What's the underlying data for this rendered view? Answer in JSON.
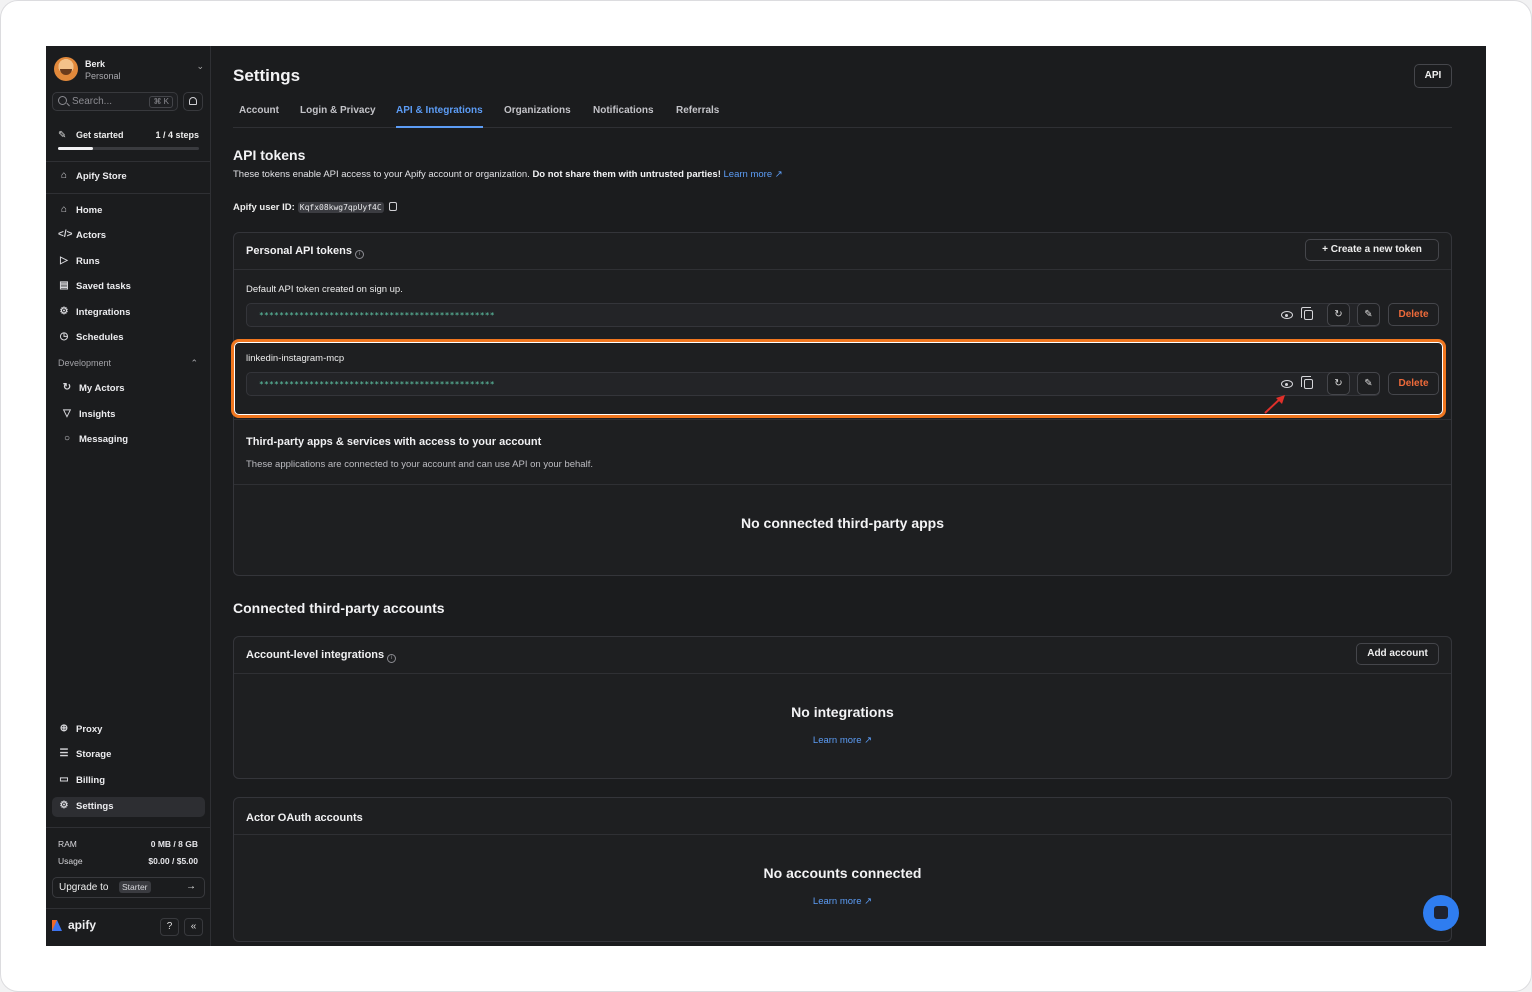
{
  "user": {
    "name": "Berk",
    "plan": "Personal"
  },
  "search": {
    "placeholder": "Search...",
    "shortcut": "⌘ K"
  },
  "get_started": {
    "label": "Get started",
    "steps": "1 / 4 steps",
    "progress": 0.25
  },
  "sidebar": {
    "store": "Apify Store",
    "items": [
      "Home",
      "Actors",
      "Runs",
      "Saved tasks",
      "Integrations",
      "Schedules"
    ],
    "development_label": "Development",
    "dev_items": [
      "My Actors",
      "Insights",
      "Messaging"
    ],
    "bottom_items": [
      "Proxy",
      "Storage",
      "Billing",
      "Settings"
    ],
    "ram_label": "RAM",
    "ram_value": "0 MB / 8 GB",
    "usage_label": "Usage",
    "usage_value": "$0.00 / $5.00",
    "upgrade_label": "Upgrade to",
    "upgrade_badge": "Starter",
    "logo_text": "apify"
  },
  "page": {
    "title": "Settings",
    "api_button": "API",
    "tabs": [
      "Account",
      "Login & Privacy",
      "API & Integrations",
      "Organizations",
      "Notifications",
      "Referrals"
    ],
    "active_tab": "API & Integrations"
  },
  "api_tokens": {
    "title": "API tokens",
    "desc_plain": "These tokens enable API access to your Apify account or organization.",
    "desc_bold": "Do not share them with untrusted parties!",
    "learn_more": "Learn more ↗",
    "user_id_label": "Apify user ID:",
    "user_id": "Kqfx08kwg7qpUyf4C"
  },
  "personal_tokens": {
    "title": "Personal API tokens",
    "create_button": "+ Create a new token",
    "tokens": [
      {
        "label": "Default API token created on sign up.",
        "mask": "***********************************************",
        "delete": "Delete"
      },
      {
        "label": "linkedin-instagram-mcp",
        "mask": "***********************************************",
        "delete": "Delete"
      }
    ]
  },
  "third_party": {
    "title": "Third-party apps & services with access to your account",
    "subtitle": "These applications are connected to your account and can use API on your behalf.",
    "empty": "No connected third-party apps"
  },
  "connected_accounts": {
    "title": "Connected third-party accounts",
    "account_level": {
      "title": "Account-level integrations",
      "button": "Add account",
      "empty": "No integrations",
      "learn_more": "Learn more ↗"
    },
    "oauth": {
      "title": "Actor OAuth accounts",
      "empty": "No accounts connected",
      "learn_more": "Learn more ↗"
    }
  },
  "colors": {
    "accent": "#5c9cf5",
    "highlight": "#f0761f",
    "danger": "#ee6a3a",
    "token_text": "#5fc8a8"
  }
}
